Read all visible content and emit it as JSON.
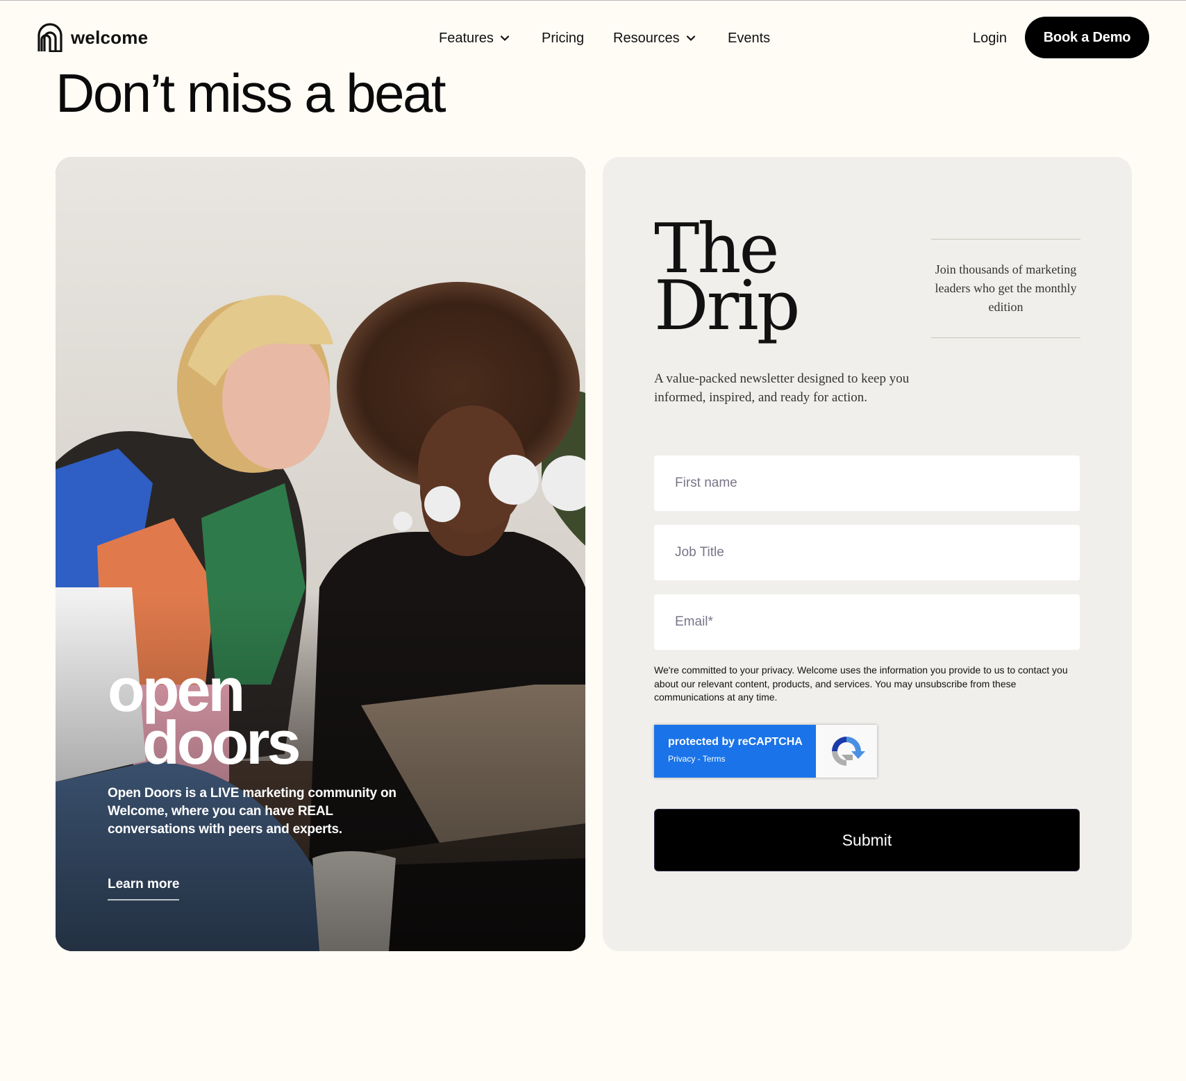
{
  "header": {
    "logo_text": "welcome",
    "nav": [
      {
        "label": "Features",
        "has_dropdown": true
      },
      {
        "label": "Pricing",
        "has_dropdown": false
      },
      {
        "label": "Resources",
        "has_dropdown": true
      },
      {
        "label": "Events",
        "has_dropdown": false
      }
    ],
    "login_label": "Login",
    "cta_label": "Book a Demo"
  },
  "page_title": "Don’t miss a beat",
  "promo": {
    "title_line1": "open",
    "title_line2": "doors",
    "description": "Open Doors is a LIVE marketing community on Welcome, where you can have REAL conversations with peers and experts.",
    "link_label": "Learn more"
  },
  "newsletter": {
    "title_line1": "The",
    "title_line2": "Drip",
    "side_text": "Join thousands of marketing leaders who get the monthly edition",
    "description": "A value-packed newsletter designed to keep you informed, inspired, and ready for action.",
    "fields": {
      "first_name_placeholder": "First name",
      "job_title_placeholder": "Job Title",
      "email_placeholder": "Email*"
    },
    "privacy_text": "We're committed to your privacy. Welcome uses the information you provide to us to contact you about our relevant content, products, and services. You may unsubscribe from these communications at any time.",
    "recaptcha": {
      "title": "protected by reCAPTCHA",
      "links": "Privacy - Terms"
    },
    "submit_label": "Submit"
  },
  "colors": {
    "page_bg": "#fffcf5",
    "form_card_bg": "#f1efeb",
    "button_bg": "#000000",
    "recaptcha_blue": "#1a73e8"
  }
}
